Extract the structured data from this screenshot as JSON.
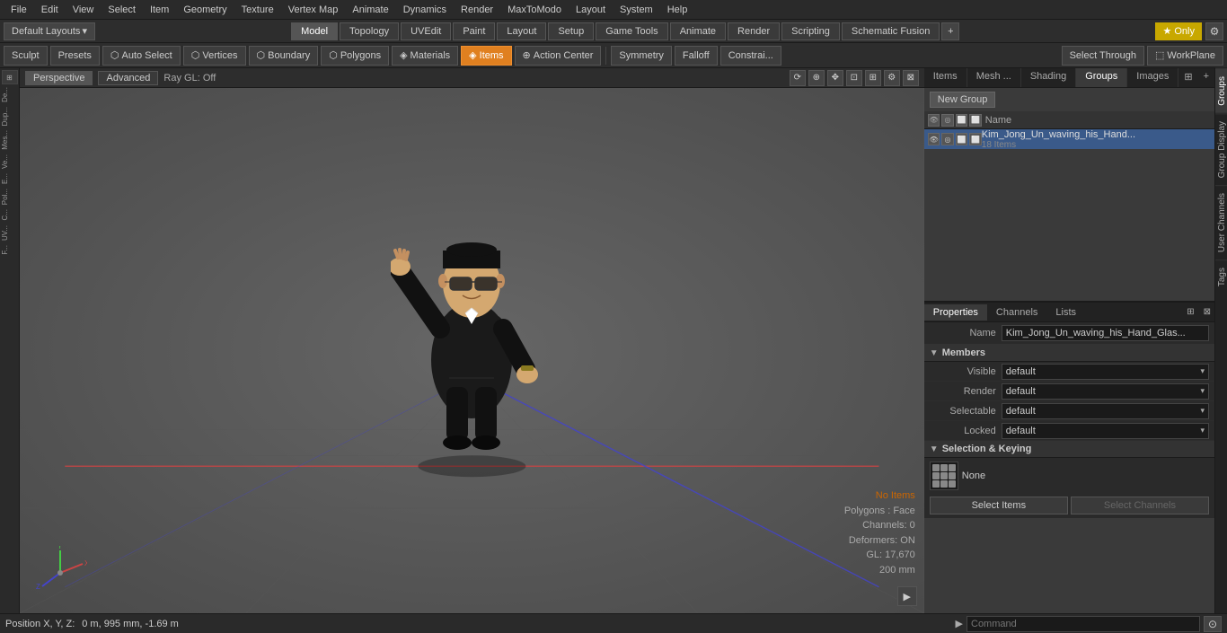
{
  "menubar": {
    "items": [
      "File",
      "Edit",
      "View",
      "Select",
      "Item",
      "Geometry",
      "Texture",
      "Vertex Map",
      "Animate",
      "Dynamics",
      "Render",
      "MaxToModo",
      "Layout",
      "System",
      "Help"
    ]
  },
  "toolbar1": {
    "layout_label": "Default Layouts",
    "tabs": [
      "Model",
      "Topology",
      "UVEdit",
      "Paint",
      "Layout",
      "Setup",
      "Game Tools",
      "Animate",
      "Render",
      "Scripting",
      "Schematic Fusion"
    ],
    "active_tab": "Model",
    "star_label": "Only",
    "plus_symbol": "+"
  },
  "toolbar2": {
    "sculpt_label": "Sculpt",
    "presets_label": "Presets",
    "auto_select_label": "Auto Select",
    "vertices_label": "Vertices",
    "boundary_label": "Boundary",
    "polygons_label": "Polygons",
    "materials_label": "Materials",
    "items_label": "Items",
    "action_center_label": "Action Center",
    "symmetry_label": "Symmetry",
    "falloff_label": "Falloff",
    "constrain_label": "Constrai...",
    "select_through_label": "Select Through",
    "workplane_label": "WorkPlane"
  },
  "viewport": {
    "tabs": [
      "Perspective",
      "Advanced"
    ],
    "raygl": "Ray GL: Off",
    "hud": {
      "no_items": "No Items",
      "polygons": "Polygons : Face",
      "channels": "Channels: 0",
      "deformers": "Deformers: ON",
      "gl": "GL: 17,670",
      "size": "200 mm"
    }
  },
  "right_panel": {
    "tabs": [
      "Items",
      "Mesh ...",
      "Shading",
      "Groups",
      "Images"
    ],
    "active_tab": "Groups",
    "new_group_label": "New Group",
    "list_columns": {
      "name": "Name"
    },
    "groups": [
      {
        "name": "Kim_Jong_Un_waving_his_Hand...",
        "count": "18 Items",
        "selected": true
      }
    ]
  },
  "properties": {
    "tabs": [
      "Properties",
      "Channels",
      "Lists"
    ],
    "active_tab": "Properties",
    "name_label": "Name",
    "name_value": "Kim_Jong_Un_waving_his_Hand_Glas...",
    "sections": {
      "members": "Members",
      "selection_keying": "Selection & Keying"
    },
    "members": {
      "visible_label": "Visible",
      "visible_value": "default",
      "render_label": "Render",
      "render_value": "default",
      "selectable_label": "Selectable",
      "selectable_value": "default",
      "locked_label": "Locked",
      "locked_value": "default"
    },
    "keying": {
      "icon_label": "None",
      "select_items_label": "Select Items",
      "select_channels_label": "Select Channels"
    }
  },
  "vtabs": [
    "Groups",
    "Group Display",
    "User Channels",
    "Tags"
  ],
  "bottom": {
    "position_label": "Position X, Y, Z:",
    "position_value": "0 m, 995 mm, -1.69 m",
    "command_placeholder": "Command",
    "arrow": "▶"
  }
}
